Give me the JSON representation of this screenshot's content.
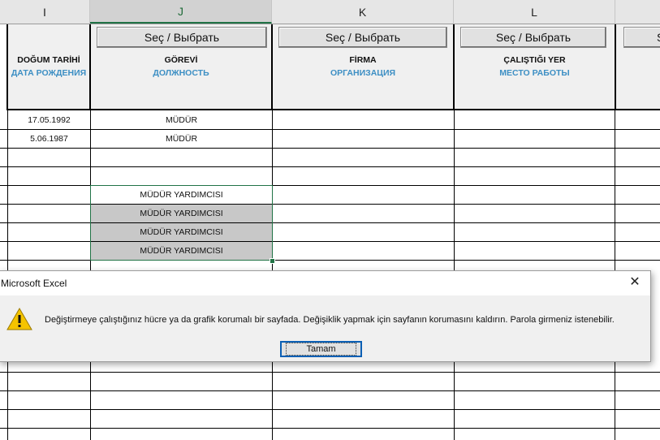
{
  "columns": [
    {
      "letter": "I"
    },
    {
      "letter": "J"
    },
    {
      "letter": "K"
    },
    {
      "letter": "L"
    },
    {
      "letter": ""
    }
  ],
  "header_cells": {
    "I": {
      "tr": "DOĞUM TARİHİ",
      "ru": "ДАТА РОЖДЕНИЯ"
    },
    "J": {
      "button": "Seç / Выбрать",
      "tr": "GÖREVİ",
      "ru": "ДОЛЖНОСТЬ"
    },
    "K": {
      "button": "Seç / Выбрать",
      "tr": "FİRMA",
      "ru": "ОРГАНИЗАЦИЯ"
    },
    "L": {
      "button": "Seç / Выбрать",
      "tr": "ÇALIŞTIĞI YER",
      "ru": "МЕСТО РАБОТЫ"
    },
    "M": {
      "button": "S"
    }
  },
  "rows": [
    {
      "birth_date": "17.05.1992",
      "position": "MÜDÜR"
    },
    {
      "birth_date": "5.06.1987",
      "position": "MÜDÜR"
    },
    {
      "birth_date": "",
      "position": ""
    },
    {
      "birth_date": "",
      "position": ""
    },
    {
      "birth_date": "",
      "position": "MÜDÜR YARDIMCISI"
    },
    {
      "birth_date": "",
      "position": "MÜDÜR YARDIMCISI"
    },
    {
      "birth_date": "",
      "position": "MÜDÜR YARDIMCISI"
    },
    {
      "birth_date": "",
      "position": "MÜDÜR YARDIMCISI"
    }
  ],
  "dialog": {
    "title": "Microsoft Excel",
    "close_glyph": "✕",
    "icon": "warning-icon",
    "message": "Değiştirmeye çalıştığınız hücre ya da grafik korumalı bir sayfada. Değişiklik yapmak için sayfanın korumasını kaldırın. Parola girmeniz istenebilir.",
    "ok_label": "Tamam"
  },
  "colors": {
    "accent_green": "#217346",
    "russian_label": "#3d8fc4",
    "warning_yellow": "#f5c400"
  }
}
